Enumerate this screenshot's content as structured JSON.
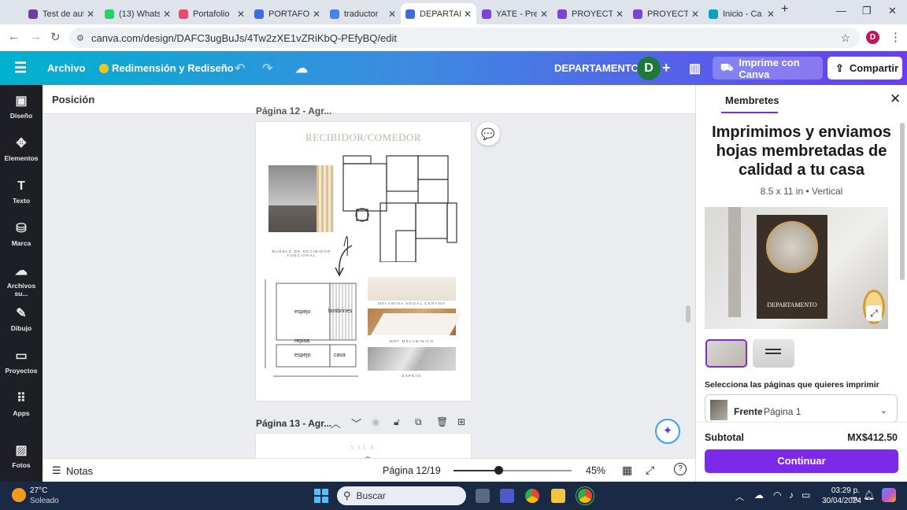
{
  "browser": {
    "tabs": [
      {
        "title": "Test de aut",
        "color": "#6b3fa0"
      },
      {
        "title": "(13) Whats",
        "color": "#25d366"
      },
      {
        "title": "Portafolio",
        "color": "#e74c6c"
      },
      {
        "title": "PORTAFOL",
        "color": "#3d6be0"
      },
      {
        "title": "traductor",
        "color": "#4285f4"
      },
      {
        "title": "DEPARTAM",
        "color": "#3d6be0"
      },
      {
        "title": "YATE - Pre",
        "color": "#7a44d8"
      },
      {
        "title": "PROYECTO",
        "color": "#7a44d8"
      },
      {
        "title": "PROYECTO",
        "color": "#7a44d8"
      },
      {
        "title": "Inicio - Ca",
        "color": "#00a3c4"
      }
    ],
    "url": "canva.com/design/DAFC3ugBuJs/4Tw2zXE1vZRiKbQ-PEfyBQ/edit"
  },
  "header": {
    "menu_icon": "hamburger-icon",
    "archivo": "Archivo",
    "redim": "Redimensión y Rediseño",
    "doc_title": "DEPARTAMENTO",
    "avatar_letter": "D",
    "print_label": "Imprime con Canva",
    "share_label": "Compartir"
  },
  "rail": [
    {
      "label": "Diseño",
      "icon": "layout-icon"
    },
    {
      "label": "Elementos",
      "icon": "shapes-icon"
    },
    {
      "label": "Texto",
      "icon": "text-icon"
    },
    {
      "label": "Marca",
      "icon": "brand-icon"
    },
    {
      "label": "Archivos su...",
      "icon": "upload-icon"
    },
    {
      "label": "Dibujo",
      "icon": "draw-icon"
    },
    {
      "label": "Proyectos",
      "icon": "folder-icon"
    },
    {
      "label": "Apps",
      "icon": "apps-icon"
    },
    {
      "label": "Fotos",
      "icon": "photos-icon"
    }
  ],
  "canvas": {
    "position_label": "Posición",
    "page12_label": "Página 12 - Agr...",
    "page13_label": "Página 13 - Agr...",
    "room_title": "RECIBIDOR/COMEDOR",
    "caption_mueble": "MUEBLE DE RECIBIDOR FUNCIONAL",
    "caption_melamina": "MELAMINA NOGAL CERANO",
    "caption_mdf": "MDF MELAMINICO",
    "caption_espejo": "ESPEJO",
    "labels": {
      "espejo1": "espejo",
      "lambrines": "lambrines",
      "repisa": "repisa",
      "espejo2": "espejo",
      "cava": "cava"
    },
    "next_page_text": "SALA"
  },
  "bottom": {
    "notes": "Notas",
    "page_indicator": "Página 12/19",
    "zoom": "45%",
    "zoom_fraction": 0.38
  },
  "panel": {
    "tab": "Membretes",
    "headline": "Imprimimos y enviamos hojas membretadas de calidad a tu casa",
    "size": "8.5 x 11 in • Vertical",
    "preview_text": "DEPARTAMENTO",
    "select_label": "Selecciona las páginas que quieres imprimir",
    "front_label": "Frente",
    "page_value": "Página 1",
    "subtotal_label": "Subtotal",
    "subtotal_value": "MX$412.50",
    "continue_label": "Continuar"
  },
  "taskbar": {
    "temp": "27°C",
    "weather": "Soleado",
    "search": "Buscar",
    "time": "03:29 p. m.",
    "date": "30/04/2024"
  }
}
